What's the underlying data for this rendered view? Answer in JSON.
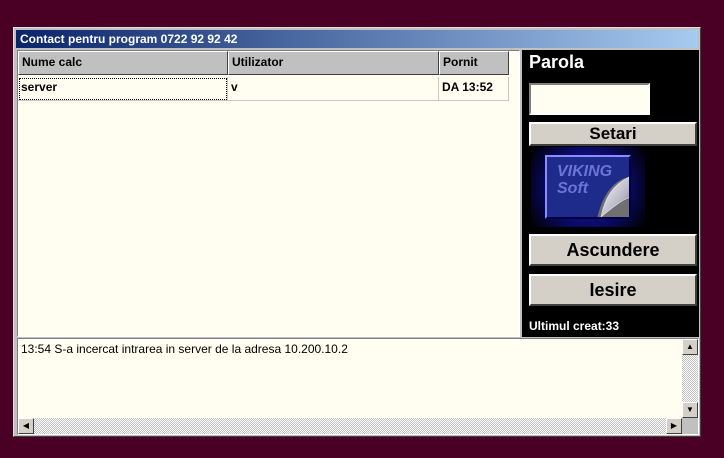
{
  "window": {
    "title": "Contact pentru program  0722 92 92 42"
  },
  "list": {
    "columns": [
      "Nume calc",
      "Utilizator",
      "Pornit"
    ],
    "rows": [
      {
        "nume": "server",
        "utilizator": "v",
        "pornit": "DA 13:52"
      }
    ]
  },
  "panel": {
    "parola_label": "Parola",
    "parola_value": "",
    "setari_label": "Setari",
    "logo_text_1": "VIKING",
    "logo_text_2": "Soft",
    "ascundere_label": "Ascundere",
    "iesire_label": "Iesire",
    "ultimul_creat": "Ultimul creat:33"
  },
  "log": {
    "line1": "13:54 S-a incercat intrarea in server de la adresa 10.200.10.2"
  },
  "icons": {
    "up": "triangle-up",
    "down": "triangle-down",
    "left": "triangle-left",
    "right": "triangle-right"
  }
}
